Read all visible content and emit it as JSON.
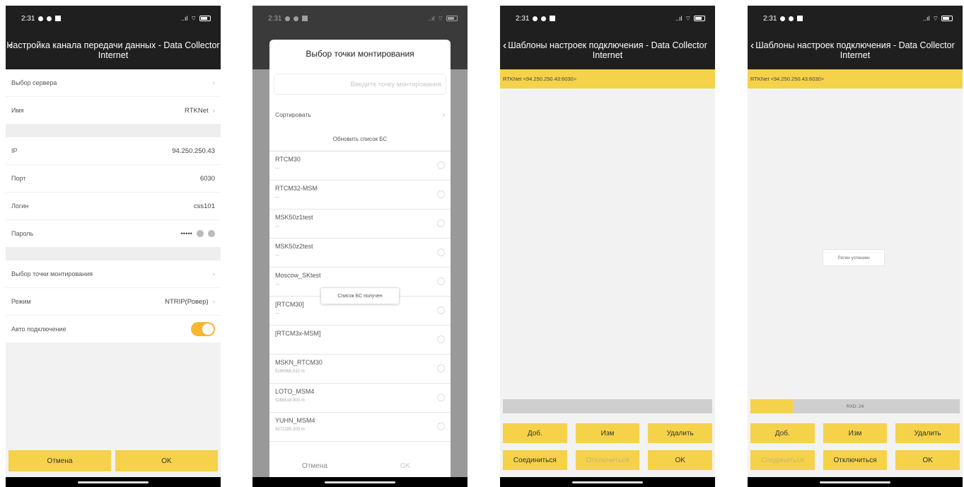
{
  "status": {
    "time": "2:31",
    "signal": "..ıl"
  },
  "screen1": {
    "title_line1": "Настройка канала передачи данных - Data Collector",
    "title_line2": "Internet",
    "rows": [
      {
        "label": "Выбор сервера",
        "value": ""
      },
      {
        "label": "Имя",
        "value": "RTKNet"
      },
      {
        "label": "IP",
        "value": "94.250.250.43"
      },
      {
        "label": "Порт",
        "value": "6030"
      },
      {
        "label": "Логин",
        "value": "css101"
      },
      {
        "label": "Пароль",
        "value": "•••••"
      },
      {
        "label": "Выбор точки монтирования",
        "value": ""
      },
      {
        "label": "Режим",
        "value": "NTRIP(Ровер)"
      },
      {
        "label": "Авто подключение",
        "value": ""
      }
    ],
    "cancel": "Отмена",
    "ok": "OK"
  },
  "screen2": {
    "dialog_title": "Выбор точки монтирования",
    "search_placeholder": "Введите точку монтирования",
    "sort_label": "Сортировать",
    "refresh_label": "Обновить список БС",
    "items": [
      {
        "name": "RTCM30",
        "sub": "—"
      },
      {
        "name": "RTCM32-MSM",
        "sub": "—"
      },
      {
        "name": "MSK50z1test",
        "sub": "—"
      },
      {
        "name": "MSK50z2test",
        "sub": "—"
      },
      {
        "name": "Moscow_SKtest",
        "sub": "—"
      },
      {
        "name": "[RTCM30]",
        "sub": "—"
      },
      {
        "name": "[RTCM3x-MSM]",
        "sub": ""
      },
      {
        "name": "MSKN_RTCM30",
        "sub": "5188965.532 m"
      },
      {
        "name": "LOTO_MSM4",
        "sub": "5266518.900 m"
      },
      {
        "name": "YUHN_MSM4",
        "sub": "4272185.300 m"
      }
    ],
    "toast": "Список БС получен",
    "cancel": "Отмена",
    "ok": "OK"
  },
  "screen3": {
    "title_line1": "Шаблоны настроек подключения - Data Collector",
    "title_line2": "Internet",
    "template": "RTKNet <94.250.250.43:6030>",
    "btn_add": "Доб.",
    "btn_edit": "Изм",
    "btn_delete": "Удалить",
    "btn_connect": "Соединиться",
    "btn_disconnect": "Отключиться",
    "btn_ok": "OK"
  },
  "screen4": {
    "title_line1": "Шаблоны настроек подключения - Data Collector",
    "title_line2": "Internet",
    "template": "RTKNet <94.250.250.43:6030>",
    "toast": "Логин успешен",
    "progress_text": "RXD: 24",
    "btn_add": "Доб.",
    "btn_edit": "Изм",
    "btn_delete": "Удалить",
    "btn_connect": "Соединиться",
    "btn_disconnect": "Отключиться",
    "btn_ok": "OK"
  },
  "colors": {
    "accent": "#f5d24a",
    "toggle": "#f5b82e",
    "header": "#1f1f1f"
  }
}
